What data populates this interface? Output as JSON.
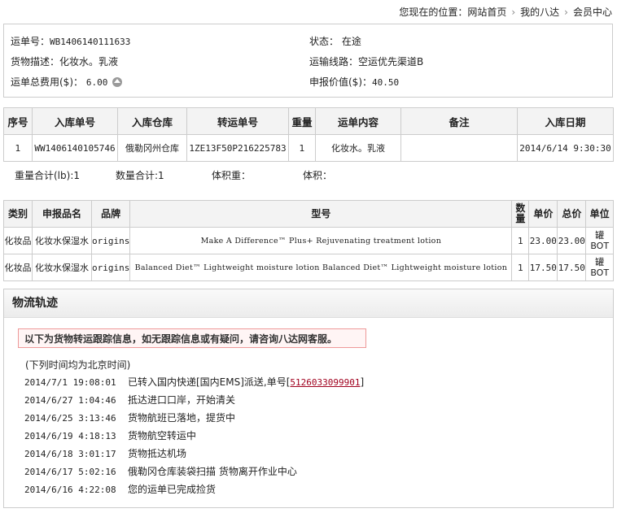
{
  "breadcrumb": {
    "prefix": "您现在的位置：",
    "items": [
      "网站首页",
      "我的八达",
      "会员中心"
    ]
  },
  "summary": {
    "waybill_label": "运单号：",
    "waybill_value": "WB1406140111633",
    "status_label": "状态：",
    "status_value": "在途",
    "desc_label": "货物描述：",
    "desc_value": "化妆水。乳液",
    "route_label": "运输线路：",
    "route_value": "空运优先渠道B",
    "fee_label": "运单总费用($)：",
    "fee_value": "6.00",
    "declared_label": "申报价值($)：",
    "declared_value": "40.50"
  },
  "inbound_table": {
    "headers": [
      "序号",
      "入库单号",
      "入库仓库",
      "转运单号",
      "重量",
      "运单内容",
      "备注",
      "入库日期"
    ],
    "rows": [
      [
        "1",
        "WW1406140105746",
        "俄勒冈州仓库",
        "1ZE13F50P216225783",
        "1",
        "化妆水。乳液",
        "",
        "2014/6/14 9:30:30"
      ]
    ]
  },
  "totals": {
    "weight": "重量合计(lb):1",
    "quantity": "数量合计:1",
    "volume_weight": "体积重：",
    "volume": "体积："
  },
  "declare_table": {
    "headers": [
      "类别",
      "申报品名",
      "品牌",
      "型号",
      "数量",
      "单价",
      "总价",
      "单位"
    ],
    "rows": [
      [
        "化妆品",
        "化妆水保湿水",
        "origins",
        "Make A Difference™ Plus+ Rejuvenating treatment lotion",
        "1",
        "23.00",
        "23.00",
        "罐BOT"
      ],
      [
        "化妆品",
        "化妆水保湿水",
        "origins",
        "Balanced Diet™ Lightweight moisture lotion Balanced Diet™ Lightweight moisture lotion",
        "1",
        "17.50",
        "17.50",
        "罐BOT"
      ]
    ]
  },
  "logistics": {
    "title": "物流轨迹",
    "notice": "以下为货物转运跟踪信息，如无跟踪信息或有疑问，请咨询八达网客服。",
    "timezone_note": "(下列时间均为北京时间)",
    "events": [
      {
        "time": "2014/7/1 19:08:01",
        "text": "已转入国内快递[国内EMS]派送,单号[",
        "link": "5126033099901",
        "suffix": "]"
      },
      {
        "time": "2014/6/27 1:04:46",
        "text": "抵达进口口岸，开始清关"
      },
      {
        "time": "2014/6/25 3:13:46",
        "text": "货物航班已落地，提货中"
      },
      {
        "time": "2014/6/19 4:18:13",
        "text": "货物航空转运中"
      },
      {
        "time": "2014/6/18 3:01:17",
        "text": "货物抵达机场"
      },
      {
        "time": "2014/6/17 5:02:16",
        "text": "俄勒冈仓库装袋扫描 货物离开作业中心"
      },
      {
        "time": "2014/6/16 4:22:08",
        "text": "您的运单已完成捡货"
      }
    ]
  }
}
